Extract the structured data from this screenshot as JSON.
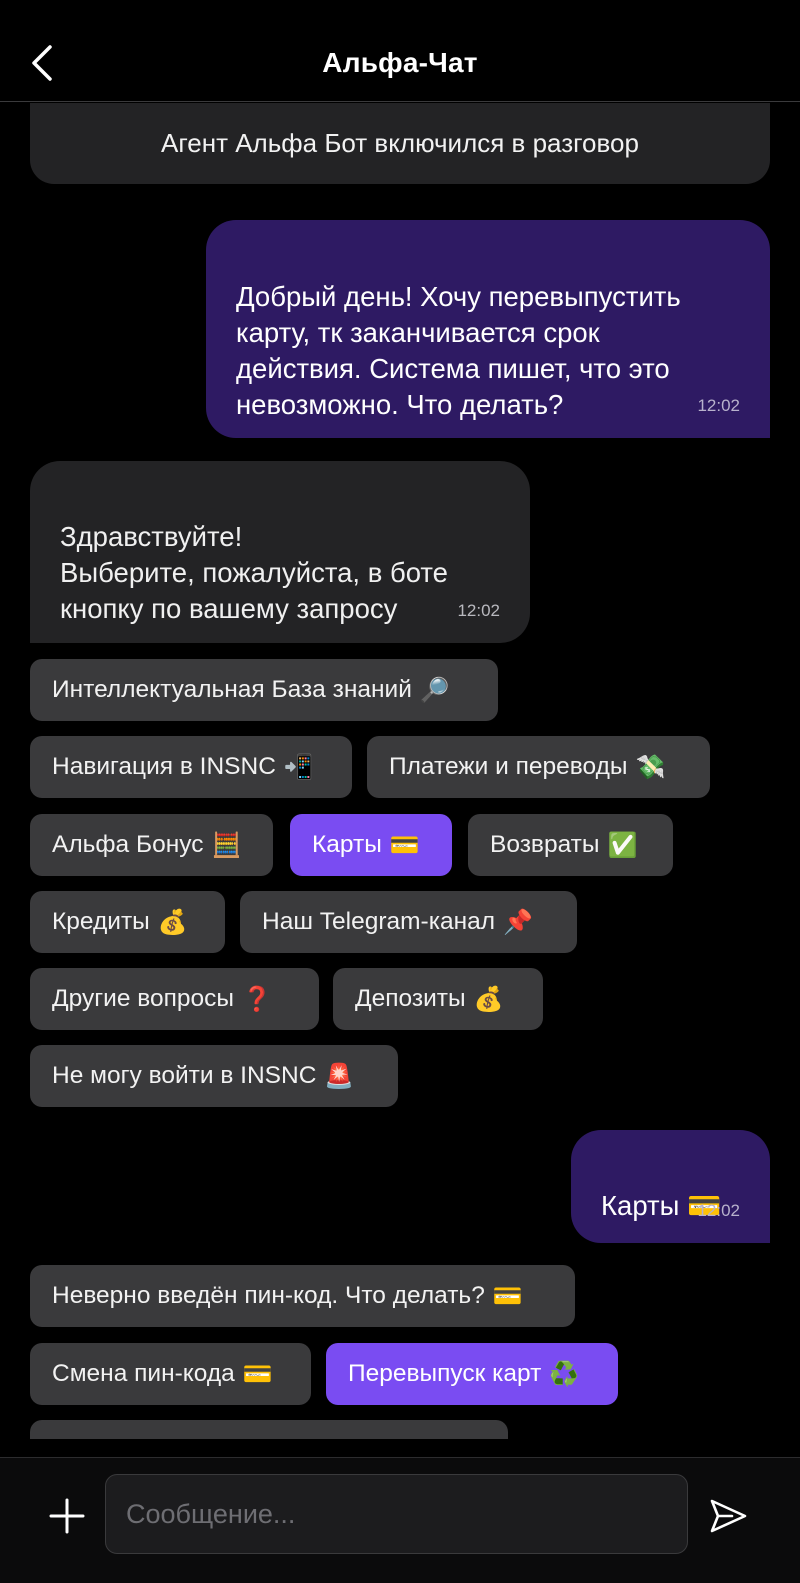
{
  "header": {
    "title": "Альфа-Чат",
    "back_icon": "chevron-left-icon"
  },
  "system": {
    "text": "Агент Альфа Бот включился в разговор"
  },
  "messages": [
    {
      "direction": "out",
      "text": "Добрый день! Хочу перевыпустить\nкарту, тк заканчивается срок\nдействия. Система пишет, что это\nневозможно. Что делать?",
      "time": "12:02"
    },
    {
      "direction": "in",
      "text": "Здравствуйте!\nВыберите, пожалуйста, в боте\nкнопку по вашему запросу",
      "time": "12:02"
    },
    {
      "direction": "out",
      "text": "Карты 💳",
      "time": "12:02"
    }
  ],
  "quick_replies_1": [
    {
      "label": "Интеллектуальная База знаний",
      "emoji": "🔎",
      "active": false
    },
    {
      "label": "Навигация в INSNC",
      "emoji": "📲",
      "active": false
    },
    {
      "label": "Платежи и переводы",
      "emoji": "💸",
      "active": false
    },
    {
      "label": "Альфа Бонус",
      "emoji": "🧮",
      "active": false
    },
    {
      "label": "Карты",
      "emoji": "💳",
      "active": true
    },
    {
      "label": "Возвраты",
      "emoji": "✅",
      "active": false
    },
    {
      "label": "Кредиты",
      "emoji": "💰",
      "active": false
    },
    {
      "label": "Наш Telegram-канал",
      "emoji": "📌",
      "active": false
    },
    {
      "label": "Другие вопросы",
      "emoji": "❓",
      "active": false
    },
    {
      "label": "Депозиты",
      "emoji": "💰",
      "active": false
    },
    {
      "label": "Не могу войти в INSNC",
      "emoji": "🚨",
      "active": false
    }
  ],
  "quick_replies_2": [
    {
      "label": "Неверно введён пин-код. Что делать?",
      "emoji": "💳",
      "active": false
    },
    {
      "label": "Смена пин-кода",
      "emoji": "💳",
      "active": false
    },
    {
      "label": "Перевыпуск карт",
      "emoji": "♻️",
      "active": true
    }
  ],
  "composer": {
    "placeholder": "Сообщение...",
    "add_icon": "plus-icon",
    "send_icon": "send-icon"
  },
  "colors": {
    "background": "#000000",
    "bubble_out": "#2E1A63",
    "bubble_in": "#232325",
    "chip": "#3A3A3C",
    "chip_active": "#7A4CF2"
  }
}
